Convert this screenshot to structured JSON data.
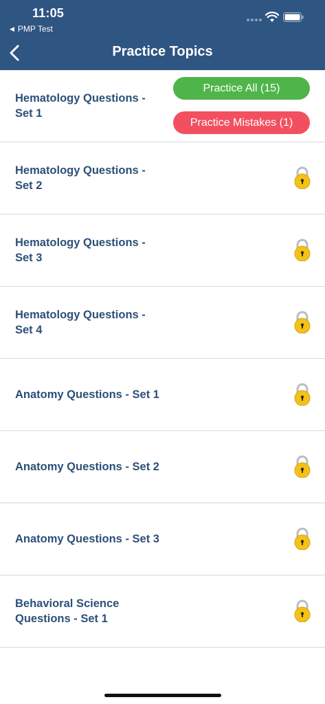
{
  "status_bar": {
    "time": "11:05",
    "back_app_label": "PMP Test"
  },
  "nav": {
    "title": "Practice Topics"
  },
  "topics": [
    {
      "title": "Hematology Questions - Set 1",
      "locked": false
    },
    {
      "title": "Hematology Questions - Set 2",
      "locked": true
    },
    {
      "title": "Hematology Questions - Set 3",
      "locked": true
    },
    {
      "title": "Hematology Questions - Set 4",
      "locked": true
    },
    {
      "title": "Anatomy Questions - Set 1",
      "locked": true
    },
    {
      "title": "Anatomy Questions - Set 2",
      "locked": true
    },
    {
      "title": "Anatomy Questions - Set 3",
      "locked": true
    },
    {
      "title": "Behavioral Science Questions - Set 1",
      "locked": true
    }
  ],
  "actions": {
    "practice_all": "Practice All (15)",
    "practice_mistakes": "Practice Mistakes (1)"
  },
  "colors": {
    "header": "#2f5582",
    "title_text": "#2d4f78",
    "practice_all": "#4fb54a",
    "practice_mistakes": "#f25060",
    "lock": "#f2c21b"
  }
}
